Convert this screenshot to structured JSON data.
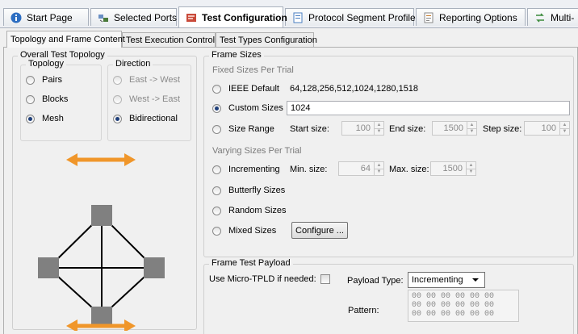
{
  "tabs": [
    {
      "label": "Start Page",
      "icon": "info-icon"
    },
    {
      "label": "Selected Ports",
      "icon": "ports-icon"
    },
    {
      "label": "Test Configuration",
      "icon": "config-icon",
      "active": true
    },
    {
      "label": "Protocol Segment Profiles",
      "icon": "document-icon"
    },
    {
      "label": "Reporting Options",
      "icon": "report-icon"
    },
    {
      "label": "Multi-",
      "icon": "multi-icon"
    }
  ],
  "subtabs": [
    {
      "label": "Topology and Frame Content",
      "active": true
    },
    {
      "label": "Test Execution Control"
    },
    {
      "label": "Test Types Configuration"
    }
  ],
  "topology": {
    "title": "Overall Test Topology",
    "topology_group": {
      "label": "Topology",
      "options": [
        {
          "label": "Pairs",
          "selected": false
        },
        {
          "label": "Blocks",
          "selected": false
        },
        {
          "label": "Mesh",
          "selected": true
        }
      ]
    },
    "direction_group": {
      "label": "Direction",
      "options": [
        {
          "label": "East -> West",
          "selected": false,
          "enabled": false
        },
        {
          "label": "West -> East",
          "selected": false,
          "enabled": false
        },
        {
          "label": "Bidirectional",
          "selected": true,
          "enabled": true
        }
      ]
    },
    "arrow_color": "#f0962a",
    "node_color": "#808080"
  },
  "frame_sizes": {
    "title": "Frame Sizes",
    "fixed_label": "Fixed Sizes Per Trial",
    "ieee_default": {
      "label": "IEEE Default",
      "value": "64,128,256,512,1024,1280,1518",
      "selected": false
    },
    "custom_sizes": {
      "label": "Custom Sizes",
      "value": "1024",
      "selected": true
    },
    "size_range": {
      "label": "Size Range",
      "selected": false,
      "start_label": "Start size:",
      "start_value": "100",
      "end_label": "End size:",
      "end_value": "1500",
      "step_label": "Step size:",
      "step_value": "100"
    },
    "varying_label": "Varying Sizes Per Trial",
    "incrementing": {
      "label": "Incrementing",
      "selected": false,
      "min_label": "Min. size:",
      "min_value": "64",
      "max_label": "Max. size:",
      "max_value": "1500"
    },
    "butterfly": {
      "label": "Butterfly Sizes",
      "selected": false
    },
    "random": {
      "label": "Random Sizes",
      "selected": false
    },
    "mixed": {
      "label": "Mixed Sizes",
      "selected": false,
      "button": "Configure ..."
    }
  },
  "payload": {
    "title": "Frame Test Payload",
    "micro_tpld_label": "Use Micro-TPLD if needed:",
    "micro_tpld_checked": false,
    "payload_type_label": "Payload Type:",
    "payload_type_value": "Incrementing",
    "pattern_label": "Pattern:",
    "pattern_rows": [
      "00 00 00 00 00 00",
      "00 00 00 00 00 00",
      "00 00 00 00 00 00"
    ]
  }
}
